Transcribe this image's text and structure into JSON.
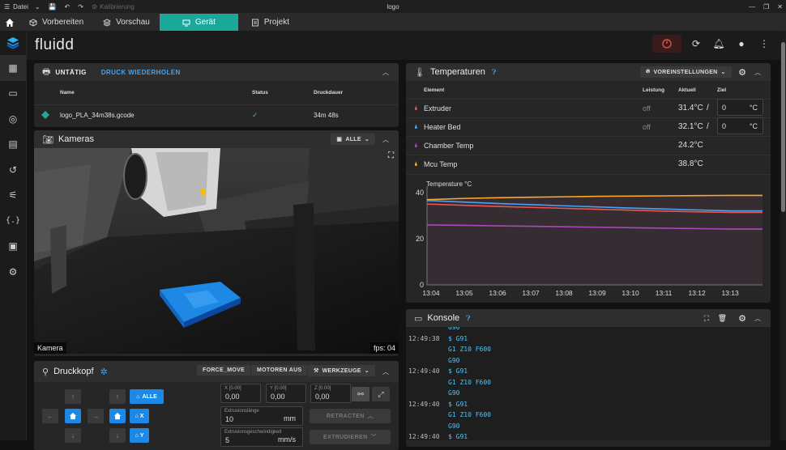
{
  "window": {
    "menu_label": "Datei",
    "dim_label": "Kalibrierung",
    "title": "logo"
  },
  "tabs": [
    {
      "label": "Vorbereiten"
    },
    {
      "label": "Vorschau"
    },
    {
      "label": "Gerät"
    },
    {
      "label": "Projekt"
    }
  ],
  "brand": "fluidd",
  "status": {
    "state": "UNTÄTIG",
    "reprint_label": "DRUCK WIEDERHOLEN",
    "columns": [
      "Name",
      "Status",
      "Druckdauer"
    ],
    "job": {
      "name": "logo_PLA_34m38s.gcode",
      "duration": "34m 48s"
    }
  },
  "cameras": {
    "title": "Kameras",
    "all_label": "ALLE",
    "camera_name": "Kamera",
    "fps": "fps: 04"
  },
  "toolhead": {
    "title": "Druckkopf",
    "force_move": "FORCE_MOVE",
    "motors_off": "MOTOREN AUS",
    "tools": "WERKZEUGE",
    "home_all": "ALLE",
    "home_x": "X",
    "home_y": "Y",
    "x_label": "X [0.00]",
    "x_value": "0,00",
    "y_label": "Y [0.00]",
    "y_value": "0,00",
    "z_label": "Z [0.00]",
    "z_value": "0,00",
    "extrude_len_label": "Extrusionslänge",
    "extrude_len_value": "10",
    "extrude_len_unit": "mm",
    "extrude_speed_label": "Extrusionsgeschwindigkeit",
    "extrude_speed_value": "5",
    "extrude_speed_unit": "mm/s",
    "retract": "RETRACTEN",
    "extrude": "EXTRUDIEREN"
  },
  "temperatures": {
    "title": "Temperaturen",
    "presets": "VOREINSTELLUNGEN",
    "columns": [
      "Element",
      "Leistung",
      "Aktuell",
      "Ziel"
    ],
    "rows": [
      {
        "name": "Extruder",
        "power": "off",
        "actual": "31.4°C",
        "sep": "/",
        "target": "0",
        "target_unit": "°C",
        "color": "#ef5350"
      },
      {
        "name": "Heater Bed",
        "power": "off",
        "actual": "32.1°C",
        "sep": "/",
        "target": "0",
        "target_unit": "°C",
        "color": "#42a5f5"
      },
      {
        "name": "Chamber Temp",
        "power": "",
        "actual": "24.2°C",
        "color": "#ab47bc"
      },
      {
        "name": "Mcu Temp",
        "power": "",
        "actual": "38.8°C",
        "color": "#ffa726"
      }
    ]
  },
  "chart_data": {
    "type": "line",
    "title": "",
    "ylabel": "Temperature °C",
    "xlabel": "",
    "x": [
      "13:04",
      "13:05",
      "13:06",
      "13:07",
      "13:08",
      "13:09",
      "13:10",
      "13:11",
      "13:12",
      "13:13"
    ],
    "ylim": [
      0,
      40
    ],
    "yticks": [
      0,
      20,
      40
    ],
    "grid": false,
    "series": [
      {
        "color": "#ffa726",
        "values": [
          37.0,
          37.5,
          37.8,
          38.0,
          38.2,
          38.4,
          38.5,
          38.6,
          38.7,
          38.8
        ]
      },
      {
        "color": "#ef5350",
        "values": [
          35.0,
          34.5,
          34.0,
          33.6,
          33.2,
          32.8,
          32.4,
          32.0,
          31.7,
          31.4
        ]
      },
      {
        "color": "#42a5f5",
        "values": [
          36.5,
          35.9,
          35.3,
          34.8,
          34.3,
          33.8,
          33.3,
          32.9,
          32.5,
          32.1
        ]
      },
      {
        "color": "#ab47bc",
        "values": [
          26.0,
          25.8,
          25.6,
          25.4,
          25.2,
          25.0,
          24.8,
          24.6,
          24.4,
          24.2
        ]
      }
    ]
  },
  "console": {
    "title": "Konsole",
    "lines": [
      {
        "ts": "",
        "text": "G90",
        "kind": "resp"
      },
      {
        "ts": "12:49:38",
        "text": "$ G91",
        "kind": "cmd"
      },
      {
        "ts": "",
        "text": "G1 Z10 F600",
        "kind": "resp"
      },
      {
        "ts": "",
        "text": "G90",
        "kind": "resp"
      },
      {
        "ts": "12:49:40",
        "text": "$ G91",
        "kind": "cmd"
      },
      {
        "ts": "",
        "text": "G1 Z10 F600",
        "kind": "resp"
      },
      {
        "ts": "",
        "text": "G90",
        "kind": "resp"
      },
      {
        "ts": "12:49:40",
        "text": "$ G91",
        "kind": "cmd"
      },
      {
        "ts": "",
        "text": "G1 Z10 F600",
        "kind": "resp"
      },
      {
        "ts": "",
        "text": "G90",
        "kind": "resp"
      },
      {
        "ts": "12:49:40",
        "text": "$ G91",
        "kind": "cmd"
      }
    ]
  }
}
